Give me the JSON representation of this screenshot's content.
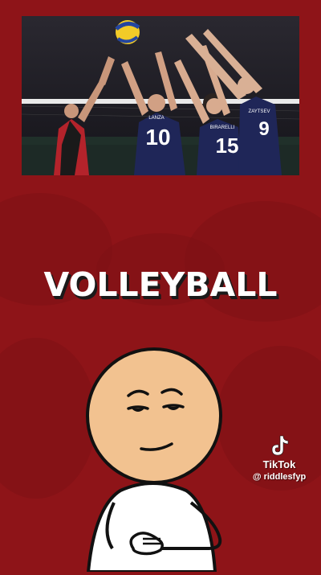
{
  "title": "VOLLEYBALL",
  "photo": {
    "jerseys": [
      {
        "name": "LANZA",
        "number": "10"
      },
      {
        "name": "BIRARELLI",
        "number": "15"
      },
      {
        "name": "ZAYTSEV",
        "number": "9"
      }
    ]
  },
  "watermark": {
    "brand": "TikTok",
    "handle": "@ riddlesfyp",
    "icon": "tiktok-note-icon"
  },
  "colors": {
    "background": "#8e1418",
    "title": "#ffffff",
    "jersey": "#1f2658"
  }
}
